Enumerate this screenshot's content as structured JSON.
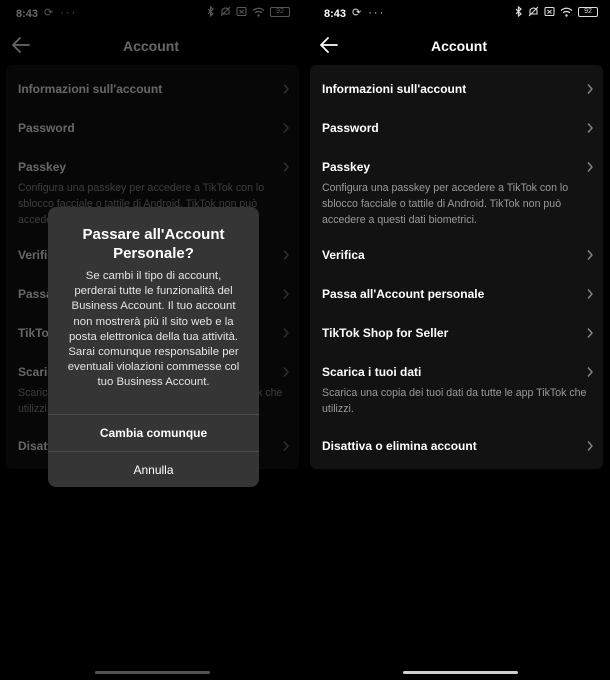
{
  "status": {
    "time": "8:43",
    "battery": "92"
  },
  "page": {
    "title": "Account"
  },
  "rows": [
    {
      "title": "Informazioni sull'account"
    },
    {
      "title": "Password"
    },
    {
      "title": "Passkey",
      "description": "Configura una passkey per accedere a TikTok con lo sblocco facciale o tattile di Android. TikTok non può accedere a questi dati biometrici."
    },
    {
      "title": "Verifica"
    },
    {
      "title": "Passa all'Account personale"
    },
    {
      "title": "TikTok Shop for Seller"
    },
    {
      "title": "Scarica i tuoi dati",
      "description": "Scarica una copia dei tuoi dati da tutte le app TikTok che utilizzi."
    },
    {
      "title": "Disattiva o elimina account"
    }
  ],
  "dialog": {
    "title": "Passare all'Account Personale?",
    "message": "Se cambi il tipo di account, perderai tutte le funzionalità del Business Account. Il tuo account non mostrerà più il sito web e la posta elettronica della tua attività. Sarai comunque responsabile per eventuali violazioni commesse col tuo Business Account.",
    "confirm_label": "Cambia comunque",
    "cancel_label": "Annulla"
  },
  "colors": {
    "background": "#000000",
    "card": "#121212",
    "dialog": "#353535",
    "secondary_text": "#9a9a9a"
  }
}
